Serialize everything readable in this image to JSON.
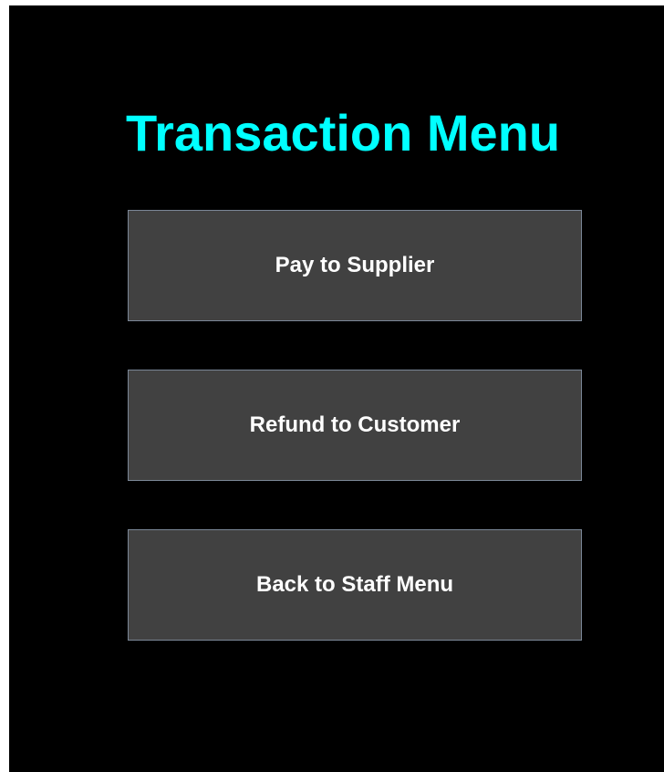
{
  "colors": {
    "background": "#000000",
    "title": "#00ffff",
    "button_bg": "#414141",
    "button_border": "#7b8797",
    "button_text": "#ffffff"
  },
  "screen": {
    "title": "Transaction Menu"
  },
  "buttons": [
    {
      "label": "Pay to Supplier"
    },
    {
      "label": "Refund to Customer"
    },
    {
      "label": "Back to Staff Menu"
    }
  ]
}
